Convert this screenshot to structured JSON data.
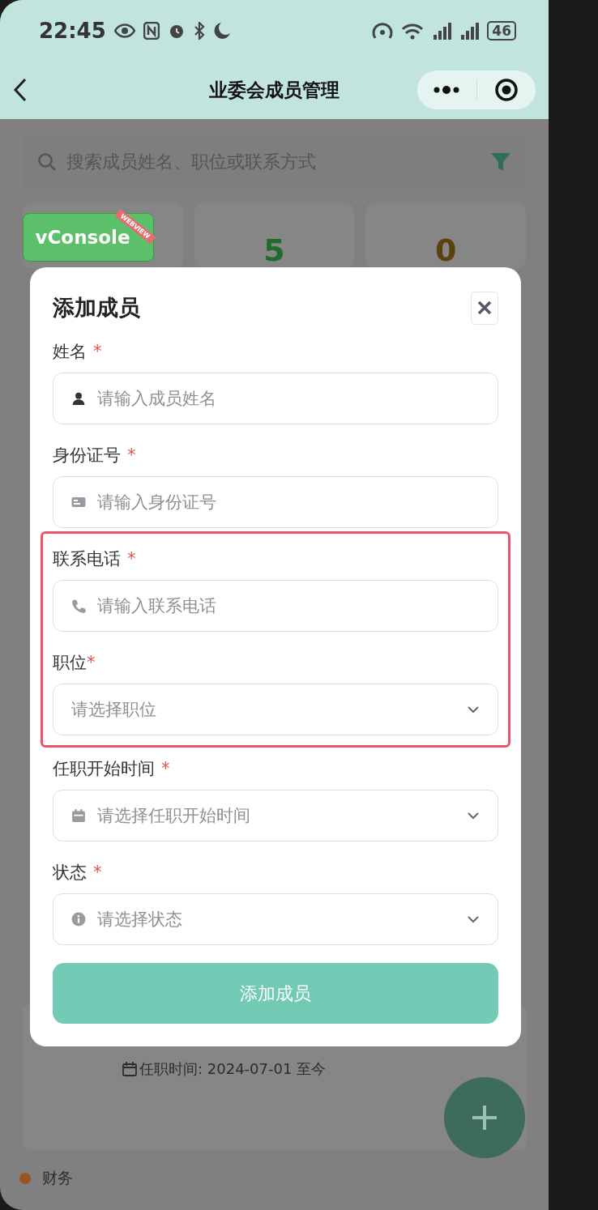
{
  "status_bar": {
    "time": "22:45",
    "battery": "46"
  },
  "nav": {
    "title": "业委会成员管理"
  },
  "search": {
    "placeholder": "搜索成员姓名、职位或联系方式"
  },
  "stats": [
    {
      "value": "5",
      "color": "#1f6a2c"
    },
    {
      "value": "0",
      "color": "#5a420c"
    }
  ],
  "vconsole": {
    "label": "vConsole",
    "ribbon": "WEBVIEW"
  },
  "member_card": {
    "term": "任职时间: 2024-07-01 至今"
  },
  "legend": [
    {
      "label": "财务",
      "color": "#9a5420"
    }
  ],
  "dialog": {
    "title": "添加成员",
    "fields": [
      {
        "label": "姓名",
        "required_mark": "*",
        "kind": "input",
        "placeholder": "请输入成员姓名",
        "highlighted": false
      },
      {
        "label": "身份证号",
        "required_mark": "*",
        "kind": "input",
        "placeholder": "请输入身份证号",
        "highlighted": false
      },
      {
        "label": "联系电话",
        "required_mark": "*",
        "kind": "input",
        "placeholder": "请输入联系电话",
        "highlighted": true
      },
      {
        "label": "职位",
        "required_mark": "*",
        "kind": "select",
        "placeholder": "请选择职位",
        "highlighted": true
      },
      {
        "label": "任职开始时间",
        "required_mark": "*",
        "kind": "select",
        "placeholder": "请选择任职开始时间",
        "highlighted": false
      },
      {
        "label": "状态",
        "required_mark": "*",
        "kind": "select",
        "placeholder": "请选择状态",
        "highlighted": false
      }
    ],
    "submit": "添加成员"
  }
}
